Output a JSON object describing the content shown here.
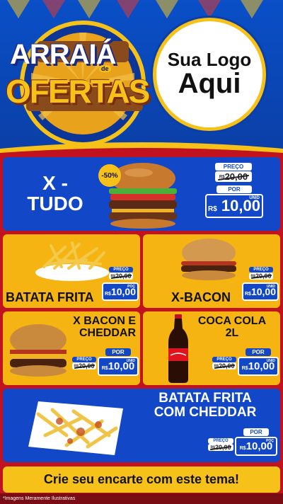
{
  "header": {
    "headline_line1": "ARRAIÁ",
    "headline_small": "de",
    "headline_line2": "OFERTAS",
    "logo_line1": "Sua Logo",
    "logo_line2": "Aqui"
  },
  "products": [
    {
      "name": "X - TUDO",
      "discount": "-50%",
      "old_label": "PREÇO",
      "old_currency": "R$",
      "old_price": "20,00",
      "new_label": "POR",
      "new_currency": "R$",
      "new_price": "10,00",
      "unit": "UNID"
    },
    {
      "name": "BATATA FRITA",
      "old_label": "PREÇO",
      "old_currency": "R$",
      "old_price": "20,00",
      "new_label": "POR",
      "new_currency": "R$",
      "new_price": "10,00",
      "unit": "POÇ"
    },
    {
      "name": "X-BACON",
      "old_label": "PREÇO",
      "old_currency": "R$",
      "old_price": "20,00",
      "new_label": "POR",
      "new_currency": "R$",
      "new_price": "10,00",
      "unit": "UNID"
    },
    {
      "name": "X BACON E CHEDDAR",
      "old_label": "PREÇO",
      "old_currency": "R$",
      "old_price": "20,00",
      "new_label": "POR",
      "new_currency": "R$",
      "new_price": "10,00",
      "unit": "UNID"
    },
    {
      "name": "COCA COLA 2L",
      "old_label": "PREÇO",
      "old_currency": "R$",
      "old_price": "20,00",
      "new_label": "POR",
      "new_currency": "R$",
      "new_price": "10,00",
      "unit": "UNID"
    },
    {
      "name": "BATATA FRITA COM CHEDDAR",
      "old_label": "PREÇO",
      "old_currency": "R$",
      "old_price": "20,00",
      "new_label": "POR",
      "new_currency": "R$",
      "new_price": "10,00",
      "unit": "POÇ"
    }
  ],
  "footer": {
    "cta": "Crie seu encarte com este tema!",
    "disclaimer": "*Imagens Meramente Ilustrativas"
  },
  "colors": {
    "blue": "#1247c8",
    "yellow": "#f6b412",
    "red": "#c1121f",
    "gold": "#f6c21a"
  }
}
